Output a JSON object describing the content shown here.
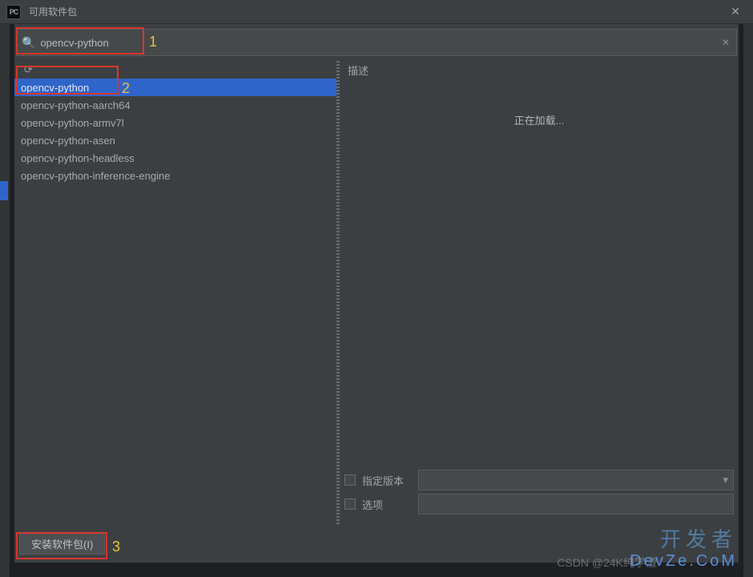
{
  "titlebar": {
    "app_icon_text": "PC",
    "title": "可用软件包"
  },
  "search": {
    "value": "opencv-python"
  },
  "packages": [
    {
      "name": "opencv-python",
      "selected": true
    },
    {
      "name": "opencv-python-aarch64",
      "selected": false
    },
    {
      "name": "opencv-python-armv7l",
      "selected": false
    },
    {
      "name": "opencv-python-asen",
      "selected": false
    },
    {
      "name": "opencv-python-headless",
      "selected": false
    },
    {
      "name": "opencv-python-inference-engine",
      "selected": false
    }
  ],
  "detail": {
    "header": "描述",
    "loading": "正在加载..."
  },
  "options": {
    "specify_version_label": "指定版本",
    "options_label": "选项"
  },
  "footer": {
    "install_label": "安装软件包(I)"
  },
  "annotations": {
    "a1": "1",
    "a2": "2",
    "a3": "3"
  },
  "watermark": {
    "cn": "开发者",
    "en": "DevZe.CoM",
    "csdn": "CSDN @24K纯学渣"
  }
}
